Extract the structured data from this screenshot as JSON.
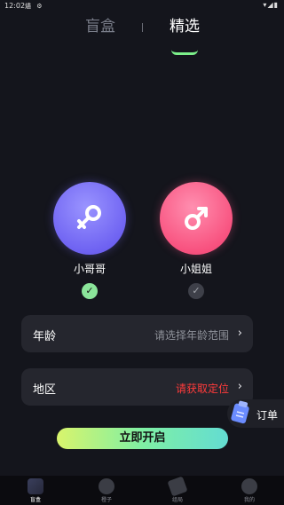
{
  "status_bar": {
    "time": "12:02",
    "left_icons": "燼 ⚙",
    "right_icons": "▾◢▮"
  },
  "tabs": {
    "blind_box": "盲盒",
    "picked": "精选"
  },
  "gender": {
    "male_label": "小哥哥",
    "female_label": "小姐姐",
    "male_checked": true,
    "female_checked": false
  },
  "form": {
    "age_label": "年龄",
    "age_value": "请选择年龄范围",
    "region_label": "地区",
    "region_value": "请获取定位"
  },
  "order": {
    "label": "订单"
  },
  "start_button": {
    "label": "立即开启"
  },
  "bottom_nav": [
    {
      "label": "盲盒",
      "icon": "box-icon"
    },
    {
      "label": "橙子",
      "icon": "bubble-icon"
    },
    {
      "label": "组局",
      "icon": "party-icon"
    },
    {
      "label": "我的",
      "icon": "profile-icon"
    }
  ],
  "colors": {
    "accent_green": "#7cf08a",
    "male_purple": "#6f63f2",
    "female_pink": "#f8527f",
    "region_red": "#ff3b3b"
  }
}
